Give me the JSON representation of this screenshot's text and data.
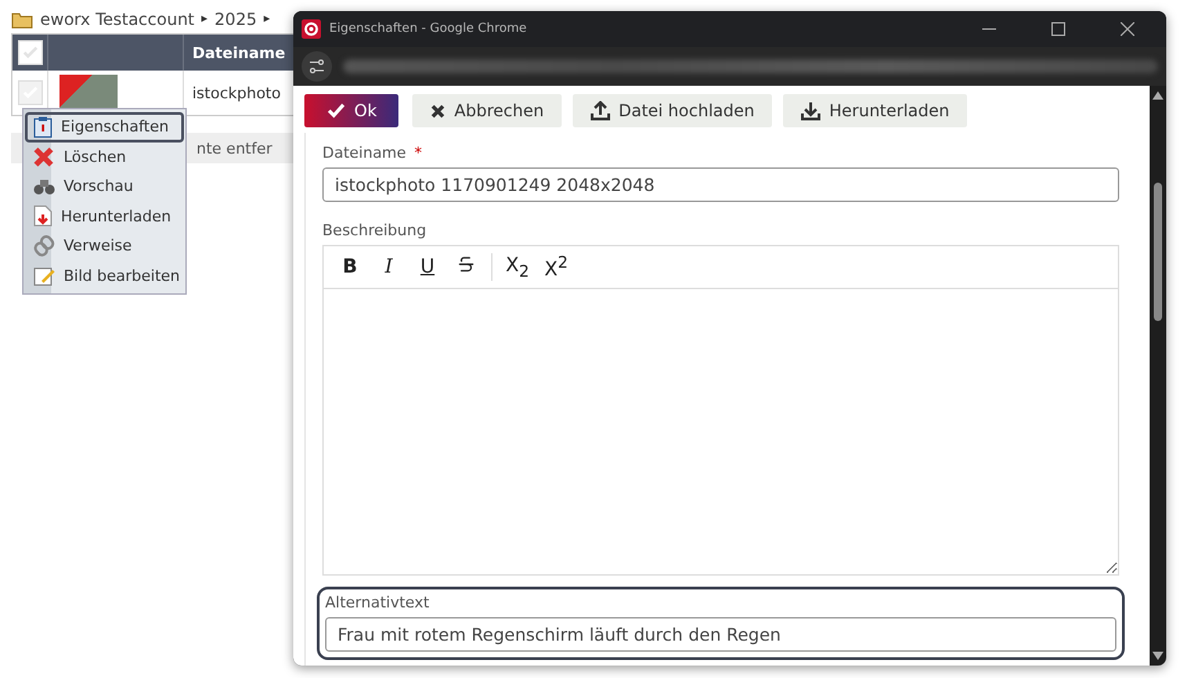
{
  "breadcrumb": {
    "items": [
      "eworx Testaccount",
      "2025"
    ],
    "separator": "▸"
  },
  "table": {
    "columns": [
      "Dateiname"
    ],
    "header_checkbox": {
      "checked": false
    },
    "rows": [
      {
        "checked": false,
        "filename": "istockphoto"
      }
    ]
  },
  "status_strip": {
    "text": "nte entfer"
  },
  "context_menu": {
    "items": [
      {
        "label": "Eigenschaften",
        "selected": true
      },
      {
        "label": "Löschen",
        "selected": false
      },
      {
        "label": "Vorschau",
        "selected": false
      },
      {
        "label": "Herunterladen",
        "selected": false
      },
      {
        "label": "Verweise",
        "selected": false
      },
      {
        "label": "Bild bearbeiten",
        "selected": false
      }
    ]
  },
  "window": {
    "title": "Eigenschaften - Google Chrome"
  },
  "toolbar": {
    "buttons": [
      {
        "label": "Ok",
        "kind": "primary"
      },
      {
        "label": "Abbrechen",
        "kind": "cancel"
      },
      {
        "label": "Datei hochladen",
        "kind": "upload"
      },
      {
        "label": "Herunterladen",
        "kind": "download"
      }
    ]
  },
  "form": {
    "filename": {
      "label": "Dateiname",
      "required_mark": "*",
      "value": "istockphoto 1170901249 2048x2048"
    },
    "description": {
      "label": "Beschreibung",
      "tools": [
        {
          "label": "B",
          "kind": "bold"
        },
        {
          "label": "I",
          "kind": "italic"
        },
        {
          "label": "U",
          "kind": "underline"
        },
        {
          "kind": "strike"
        },
        {
          "label": "X$_{2}$",
          "kind": "sub"
        },
        {
          "label": "X$^{2}$",
          "kind": "sup"
        }
      ]
    },
    "alt_text": {
      "label": "Alternativtext",
      "value": "Frau mit rotem Regenschirm läuft durch den Regen",
      "focused": true
    }
  }
}
